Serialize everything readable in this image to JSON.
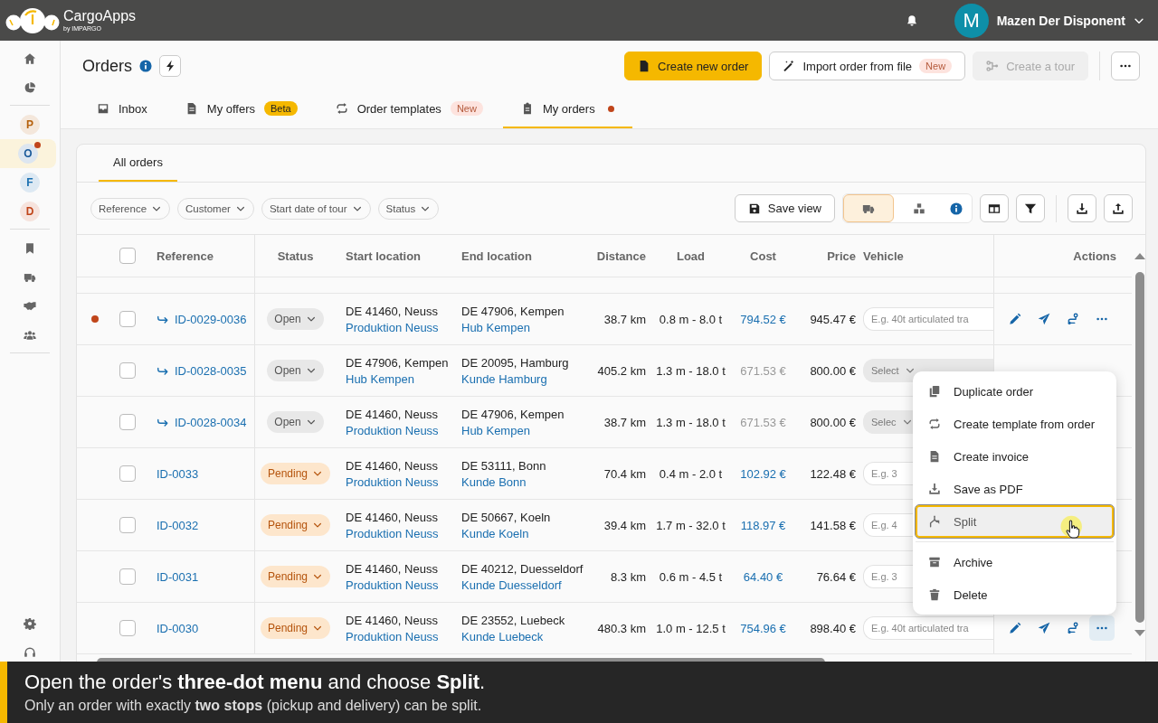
{
  "topbar": {
    "app_name": "CargoApps",
    "app_byline": "by IMPARGO",
    "user": {
      "initial": "M",
      "name": "Mazen Der Disponent"
    }
  },
  "sidebar": {
    "workspaces": [
      {
        "letter": "P",
        "color": "#b5600c",
        "selected": false,
        "badge": false
      },
      {
        "letter": "O",
        "color": "#1a5a9a",
        "selected": true,
        "badge": true
      },
      {
        "letter": "F",
        "color": "#1a6fb0",
        "selected": false,
        "badge": false
      },
      {
        "letter": "D",
        "color": "#c0451a",
        "selected": false,
        "badge": false
      }
    ]
  },
  "header": {
    "title": "Orders",
    "actions": [
      {
        "label": "Create new order",
        "kind": "primary",
        "disabled": false
      },
      {
        "label": "Import order from file",
        "kind": "secondary",
        "badge": "New",
        "disabled": false
      },
      {
        "label": "Create a tour",
        "kind": "secondary",
        "disabled": true
      }
    ]
  },
  "tabs": [
    {
      "label": "Inbox",
      "selected": false,
      "dot": false
    },
    {
      "label": "My offers",
      "badge": {
        "label": "Beta",
        "kind": "beta"
      },
      "selected": false,
      "dot": false
    },
    {
      "label": "Order templates",
      "badge": {
        "label": "New",
        "kind": "new"
      },
      "selected": false,
      "dot": false
    },
    {
      "label": "My orders",
      "selected": true,
      "dot": true
    }
  ],
  "card": {
    "subtabs": [
      {
        "label": "All orders",
        "selected": true
      }
    ],
    "filters": [
      "Reference",
      "Customer",
      "Start date of tour",
      "Status"
    ],
    "save_view": "Save view",
    "view_toggle": [
      {
        "selected": true
      },
      {
        "selected": false
      }
    ]
  },
  "table": {
    "select_all_checked": false,
    "columns": [
      "Reference",
      "Status",
      "Start location",
      "End location",
      "Distance",
      "Load",
      "Cost",
      "Price",
      "Vehicle",
      "Actions"
    ],
    "rows": [
      {
        "unread": true,
        "linked": true,
        "checked": false,
        "reference": "ID-0029-0036",
        "status": {
          "label": "Open",
          "kind": "open"
        },
        "start": {
          "address": "DE 41460, Neuss",
          "site": "Produktion Neuss"
        },
        "end": {
          "address": "DE 47906, Kempen",
          "site": "Hub Kempen"
        },
        "distance": "38.7 km",
        "load": "0.8 m - 8.0 t",
        "cost": "794.52 €",
        "cost_muted": false,
        "price": "945.47 €",
        "vehicle": {
          "kind": "input",
          "text": "E.g. 40t articulated tra"
        },
        "menu_open": false
      },
      {
        "unread": false,
        "linked": true,
        "checked": false,
        "reference": "ID-0028-0035",
        "status": {
          "label": "Open",
          "kind": "open"
        },
        "start": {
          "address": "DE 47906, Kempen",
          "site": "Hub Kempen"
        },
        "end": {
          "address": "DE 20095, Hamburg",
          "site": "Kunde Hamburg"
        },
        "distance": "405.2 km",
        "load": "1.3 m - 18.0 t",
        "cost": "671.53 €",
        "cost_muted": true,
        "price": "800.00 €",
        "vehicle": {
          "kind": "select",
          "text": "Select"
        },
        "menu_open": false
      },
      {
        "unread": false,
        "linked": true,
        "checked": false,
        "reference": "ID-0028-0034",
        "status": {
          "label": "Open",
          "kind": "open"
        },
        "start": {
          "address": "DE 41460, Neuss",
          "site": "Produktion Neuss"
        },
        "end": {
          "address": "DE 47906, Kempen",
          "site": "Hub Kempen"
        },
        "distance": "38.7 km",
        "load": "1.3 m - 18.0 t",
        "cost": "671.53 €",
        "cost_muted": true,
        "price": "800.00 €",
        "vehicle": {
          "kind": "select",
          "text": "Selec"
        },
        "menu_open": false
      },
      {
        "unread": false,
        "linked": false,
        "checked": false,
        "reference": "ID-0033",
        "status": {
          "label": "Pending",
          "kind": "pending"
        },
        "start": {
          "address": "DE 41460, Neuss",
          "site": "Produktion Neuss"
        },
        "end": {
          "address": "DE 53111, Bonn",
          "site": "Kunde Bonn"
        },
        "distance": "70.4 km",
        "load": "0.4 m - 2.0 t",
        "cost": "102.92 €",
        "cost_muted": false,
        "price": "122.48 €",
        "vehicle": {
          "kind": "input",
          "text": "E.g. 3"
        },
        "menu_open": false
      },
      {
        "unread": false,
        "linked": false,
        "checked": false,
        "reference": "ID-0032",
        "status": {
          "label": "Pending",
          "kind": "pending"
        },
        "start": {
          "address": "DE 41460, Neuss",
          "site": "Produktion Neuss"
        },
        "end": {
          "address": "DE 50667, Koeln",
          "site": "Kunde Koeln"
        },
        "distance": "39.4 km",
        "load": "1.7 m - 32.0 t",
        "cost": "118.97 €",
        "cost_muted": false,
        "price": "141.58 €",
        "vehicle": {
          "kind": "input",
          "text": "E.g. 4"
        },
        "menu_open": false
      },
      {
        "unread": false,
        "linked": false,
        "checked": false,
        "reference": "ID-0031",
        "status": {
          "label": "Pending",
          "kind": "pending"
        },
        "start": {
          "address": "DE 41460, Neuss",
          "site": "Produktion Neuss"
        },
        "end": {
          "address": "DE 40212, Duesseldorf",
          "site": "Kunde Duesseldorf"
        },
        "distance": "8.3 km",
        "load": "0.6 m - 4.5 t",
        "cost": "64.40 €",
        "cost_muted": false,
        "price": "76.64 €",
        "vehicle": {
          "kind": "input",
          "text": "E.g. 3"
        },
        "menu_open": false
      },
      {
        "unread": false,
        "linked": false,
        "checked": false,
        "reference": "ID-0030",
        "status": {
          "label": "Pending",
          "kind": "pending"
        },
        "start": {
          "address": "DE 41460, Neuss",
          "site": "Produktion Neuss"
        },
        "end": {
          "address": "DE 23552, Luebeck",
          "site": "Kunde Luebeck"
        },
        "distance": "480.3 km",
        "load": "1.0 m - 12.5 t",
        "cost": "754.96 €",
        "cost_muted": false,
        "price": "898.40 €",
        "vehicle": {
          "kind": "input",
          "text": "E.g. 40t articulated tra"
        },
        "menu_open": true
      }
    ]
  },
  "menu": {
    "groups": [
      [
        {
          "label": "Duplicate order",
          "selected": false
        },
        {
          "label": "Create template from order",
          "selected": false
        },
        {
          "label": "Create invoice",
          "selected": false
        },
        {
          "label": "Save as PDF",
          "selected": false
        },
        {
          "label": "Split",
          "selected": true
        }
      ],
      [
        {
          "label": "Archive",
          "selected": false
        },
        {
          "label": "Delete",
          "selected": false
        }
      ]
    ]
  },
  "caption": {
    "title": "Open the order's **three-dot menu** and choose **Split**.",
    "note": "Only an order with exactly **two stops** (pickup and delivery) can be split."
  }
}
